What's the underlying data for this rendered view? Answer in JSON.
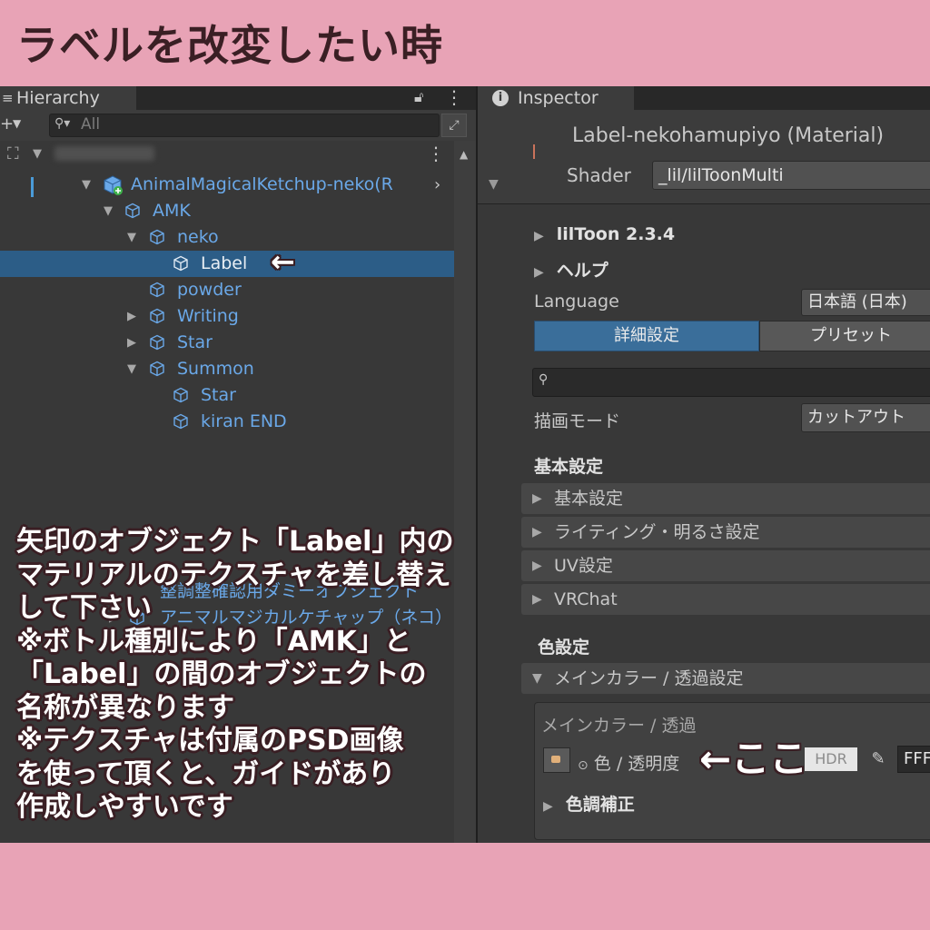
{
  "banner": {
    "title": "ラベルを改変したい時"
  },
  "hierarchy": {
    "tab_label": "Hierarchy",
    "search_placeholder": "All",
    "rows": [
      {
        "label": "AnimalMagicalKetchup-neko(R"
      },
      {
        "label": "AMK"
      },
      {
        "label": "neko"
      },
      {
        "label": "Label"
      },
      {
        "label": "powder"
      },
      {
        "label": "Writing"
      },
      {
        "label": "Star"
      },
      {
        "label": "Summon"
      },
      {
        "label": "Star"
      },
      {
        "label": "kiran END"
      },
      {
        "label": "整調整確認用ダミーオブジェクト"
      },
      {
        "label": "アニマルマジカルケチャップ（ネコ）"
      }
    ]
  },
  "inspector": {
    "tab_label": "Inspector",
    "material_title": "Label-nekohamupiyo (Material)",
    "shader_label": "Shader",
    "shader_value": "_lil/lilToonMulti",
    "liltoon_version": "lilToon 2.3.4",
    "help_label": "ヘルプ",
    "language_label": "Language",
    "language_value": "日本語 (日本)",
    "tab_advanced": "詳細設定",
    "tab_preset": "プリセット",
    "render_mode_label": "描画モード",
    "render_mode_value": "カットアウト",
    "basic_section": "基本設定",
    "folds": [
      "基本設定",
      "ライティング・明るさ設定",
      "UV設定",
      "VRChat"
    ],
    "color_section": "色設定",
    "main_color_fold": "メインカラー / 透過設定",
    "main_color_box_title": "メインカラー / 透過",
    "color_alpha_label": "色 / 透明度",
    "hdr_label": "HDR",
    "hex_value": "FFF",
    "tone_correction": "色調補正"
  },
  "annotations": {
    "label_arrow": "←",
    "here_arrow": "←ここ",
    "caption_lines": [
      "矢印のオブジェクト「Label」内の",
      "マテリアルのテクスチャを差し替え",
      "して下さい",
      "※ボトル種別により「AMK」と",
      "「Label」の間のオブジェクトの",
      "名称が異なります",
      "※テクスチャは付属のPSD画像",
      "を使って頂くと、ガイドがあり",
      "作成しやすいです"
    ]
  },
  "colors": {
    "banner": "#e8a3b6",
    "panel": "#383838",
    "selection": "#2c5d87",
    "prefab_text": "#6aa8e8",
    "caption_outline": "#3a1f24"
  }
}
